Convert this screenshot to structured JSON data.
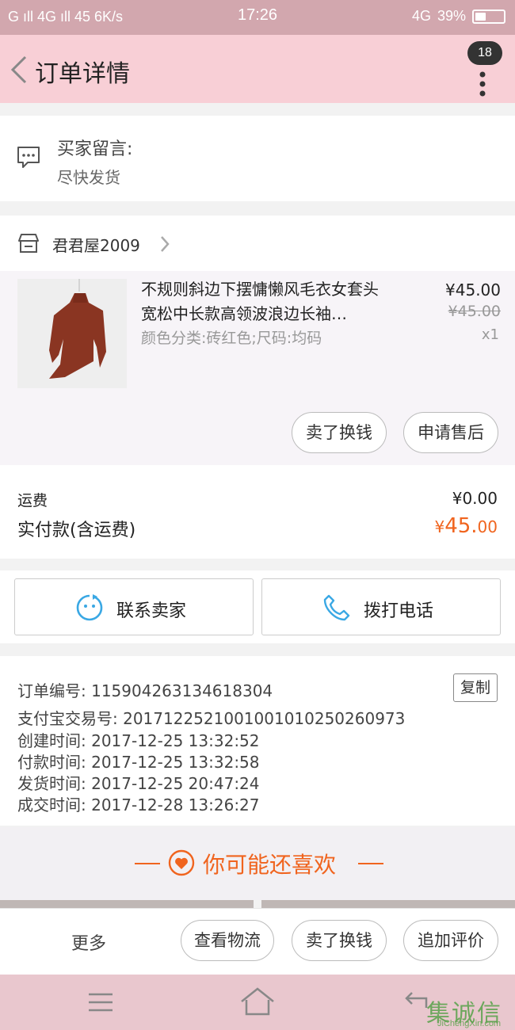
{
  "status_bar": {
    "left": "G ıll 4G ıll 45 6K/s",
    "time": "17:26",
    "network": "4G",
    "battery": "39%",
    "battery_level": 0.39
  },
  "header": {
    "title": "订单详情",
    "badge": "18"
  },
  "buyer_message": {
    "label": "买家留言:",
    "content": "尽快发货"
  },
  "shop": {
    "name": "君君屋2009"
  },
  "product": {
    "title": "不规则斜边下摆慵懒风毛衣女套头宽松中长款高领波浪边长袖…",
    "sku": "颜色分类:砖红色;尺码:均码",
    "price": "¥45.00",
    "original_price": "¥45.00",
    "quantity": "x1",
    "buttons": {
      "exchange": "卖了换钱",
      "after_sale": "申请售后"
    }
  },
  "fees": {
    "shipping_label": "运费",
    "shipping_value": "¥0.00",
    "paid_label": "实付款(含运费)",
    "paid_currency": "¥",
    "paid_integer": "45.",
    "paid_decimal": "00"
  },
  "contact": {
    "seller": "联系卖家",
    "call": "拨打电话"
  },
  "order_info": {
    "order_no": "订单编号: 115904263134618304",
    "alipay_no": "支付宝交易号: 2017122521001001010250260973",
    "created": "创建时间: 2017-12-25  13:32:52",
    "paid": "付款时间: 2017-12-25  13:32:58",
    "shipped": "发货时间: 2017-12-25  20:47:24",
    "completed": "成交时间: 2017-12-28  13:26:27",
    "copy": "复制"
  },
  "recommend": {
    "title": "你可能还喜欢"
  },
  "action_bar": {
    "more": "更多",
    "logistics": "查看物流",
    "exchange": "卖了换钱",
    "review": "追加评价"
  },
  "watermark": {
    "logo": "集诚信",
    "sub": "JiChengXin.com"
  },
  "colors": {
    "accent": "#f0641e",
    "header_bg": "#f8cfd6",
    "status_bg": "#d2a7ae",
    "contact_icon": "#3aa8e4"
  },
  "icons": [
    "back-arrow-icon",
    "more-dots-icon",
    "message-icon",
    "shop-icon",
    "chevron-right-icon",
    "smile-chat-icon",
    "phone-icon",
    "heart-icon",
    "menu-icon",
    "home-icon",
    "back-nav-icon"
  ]
}
